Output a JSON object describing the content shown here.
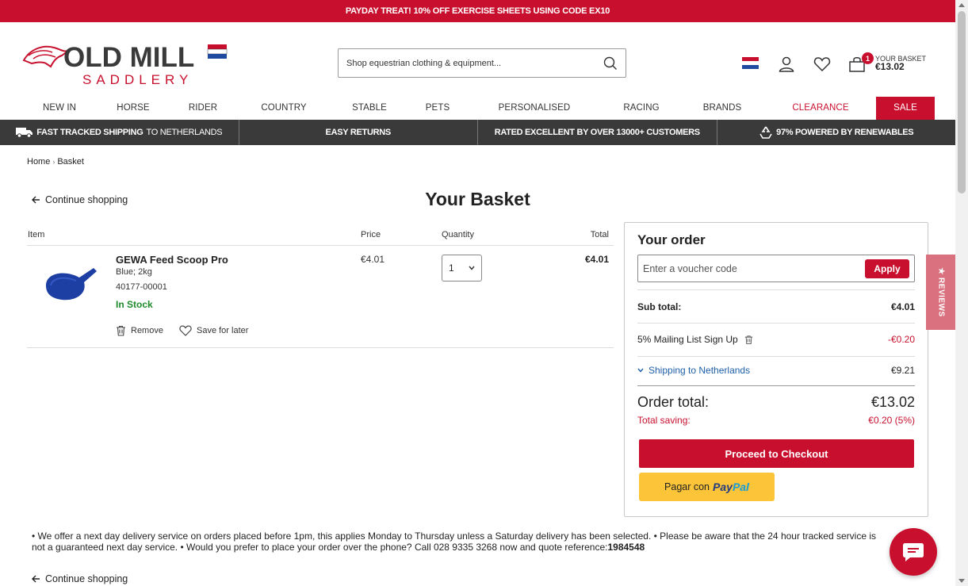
{
  "promo": {
    "text": "PAYDAY TREAT! 10% OFF EXERCISE SHEETS USING CODE EX10"
  },
  "header": {
    "logo_alt": "OLD MILL SADDLERY",
    "logo_line1": "OLD MILL",
    "logo_line2": "SADDLERY",
    "search_placeholder": "Shop equestrian clothing & equipment...",
    "basket_count": "1",
    "basket_label": "YOUR BASKET",
    "basket_amount": "€13.02"
  },
  "nav": {
    "items": [
      "NEW IN",
      "HORSE",
      "RIDER",
      "COUNTRY",
      "STABLE",
      "PETS",
      "PERSONALISED",
      "RACING",
      "BRANDS",
      "CLEARANCE",
      "SALE"
    ]
  },
  "usp": {
    "shipping_bold": "FAST TRACKED SHIPPING",
    "shipping_rest": "TO NETHERLANDS",
    "returns": "EASY RETURNS",
    "rated": "RATED EXCELLENT BY OVER 13000+ CUSTOMERS",
    "renewables": "97% POWERED BY RENEWABLES"
  },
  "breadcrumb": {
    "home": "Home",
    "current": "Basket"
  },
  "page": {
    "continue": "Continue shopping",
    "title": "Your Basket"
  },
  "table": {
    "headers": {
      "item": "Item",
      "price": "Price",
      "quantity": "Quantity",
      "total": "Total"
    },
    "rows": [
      {
        "name": "GEWA Feed Scoop Pro",
        "variant": "Blue; 2kg",
        "sku": "40177-00001",
        "stock": "In Stock",
        "price": "€4.01",
        "quantity": "1",
        "total": "€4.01",
        "remove": "Remove",
        "save": "Save for later"
      }
    ]
  },
  "order": {
    "title": "Your order",
    "voucher_placeholder": "Enter a voucher code",
    "apply": "Apply",
    "subtotal_label": "Sub total:",
    "subtotal": "€4.01",
    "discount_label": "5% Mailing List Sign Up",
    "discount": "-€0.20",
    "shipping_label": "Shipping to Netherlands",
    "shipping": "€9.21",
    "total_label": "Order total:",
    "total": "€13.02",
    "saving_label": "Total saving:",
    "saving": "€0.20 (5%)",
    "checkout": "Proceed to Checkout",
    "paypal_prefix": "Pagar con",
    "paypal_a": "Pay",
    "paypal_b": "Pal"
  },
  "reviews_tab": "★ REVIEWS",
  "notice": {
    "line1": "• We offer a next day delivery service on orders placed before 1pm, this applies Monday to Thursday unless a Saturday delivery has been selected. • Please be aware that the 24 hour tracked service is",
    "line2": "not a guaranteed next day service. • Would you prefer to place your order over the phone? Call 028 9335 3268 now and quote reference:",
    "reference": "1984548"
  },
  "colors": {
    "brand_red": "#c8102e",
    "usp_bar": "#3a3a3a",
    "in_stock": "#1f8a2b",
    "link_blue": "#1f5fa8",
    "paypal_yellow": "#fcc439"
  }
}
